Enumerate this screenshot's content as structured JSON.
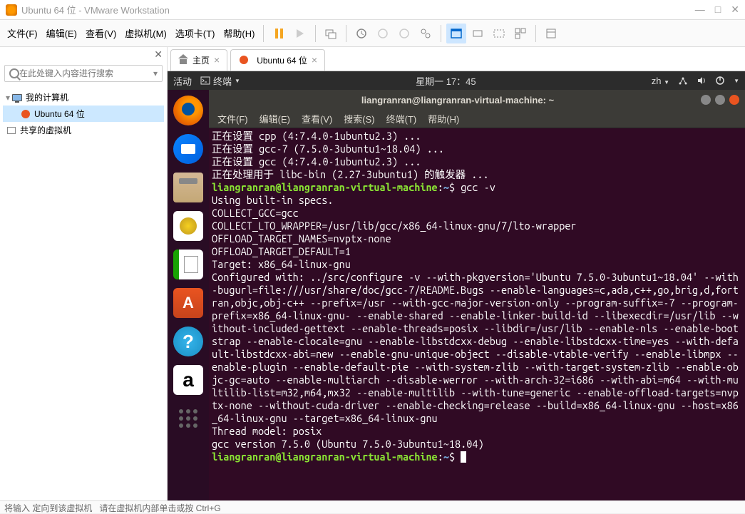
{
  "window": {
    "title": "Ubuntu 64 位 - VMware Workstation"
  },
  "menu": {
    "file": "文件(F)",
    "edit": "编辑(E)",
    "view": "查看(V)",
    "vm": "虚拟机(M)",
    "tabs": "选项卡(T)",
    "help": "帮助(H)"
  },
  "sidebar": {
    "search_placeholder": "在此处键入内容进行搜索",
    "tree": {
      "root": "我的计算机",
      "vm": "Ubuntu 64 位",
      "shared": "共享的虚拟机"
    }
  },
  "tabs": {
    "home": "主页",
    "vm": "Ubuntu 64 位"
  },
  "gnome": {
    "activities": "活动",
    "app": "终端",
    "clock": "星期一 17：45",
    "lang": "zh"
  },
  "terminal": {
    "title": "liangranran@liangranran-virtual-machine: ~",
    "menu": {
      "file": "文件(F)",
      "edit": "编辑(E)",
      "view": "查看(V)",
      "search": "搜索(S)",
      "terminal": "终端(T)",
      "help": "帮助(H)"
    },
    "lines": [
      "正在设置 cpp (4:7.4.0-1ubuntu2.3) ...",
      "正在设置 gcc-7 (7.5.0-3ubuntu1~18.04) ...",
      "正在设置 gcc (4:7.4.0-1ubuntu2.3) ...",
      "正在处理用于 libc-bin (2.27-3ubuntu1) 的触发器 ..."
    ],
    "prompt1_user": "liangranran@liangranran-virtual-machine",
    "prompt1_path": "~",
    "prompt1_cmd": "gcc -v",
    "gcc_output": "Using built-in specs.\nCOLLECT_GCC=gcc\nCOLLECT_LTO_WRAPPER=/usr/lib/gcc/x86_64-linux-gnu/7/lto-wrapper\nOFFLOAD_TARGET_NAMES=nvptx-none\nOFFLOAD_TARGET_DEFAULT=1\nTarget: x86_64-linux-gnu\nConfigured with: ../src/configure -v --with-pkgversion='Ubuntu 7.5.0-3ubuntu1~18.04' --with-bugurl=file:///usr/share/doc/gcc-7/README.Bugs --enable-languages=c,ada,c++,go,brig,d,fortran,objc,obj-c++ --prefix=/usr --with-gcc-major-version-only --program-suffix=-7 --program-prefix=x86_64-linux-gnu- --enable-shared --enable-linker-build-id --libexecdir=/usr/lib --without-included-gettext --enable-threads=posix --libdir=/usr/lib --enable-nls --enable-bootstrap --enable-clocale=gnu --enable-libstdcxx-debug --enable-libstdcxx-time=yes --with-default-libstdcxx-abi=new --enable-gnu-unique-object --disable-vtable-verify --enable-libmpx --enable-plugin --enable-default-pie --with-system-zlib --with-target-system-zlib --enable-objc-gc=auto --enable-multiarch --disable-werror --with-arch-32=i686 --with-abi=m64 --with-multilib-list=m32,m64,mx32 --enable-multilib --with-tune=generic --enable-offload-targets=nvptx-none --without-cuda-driver --enable-checking=release --build=x86_64-linux-gnu --host=x86_64-linux-gnu --target=x86_64-linux-gnu\nThread model: posix\ngcc version 7.5.0 (Ubuntu 7.5.0-3ubuntu1~18.04)",
    "prompt2_user": "liangranran@liangranran-virtual-machine",
    "prompt2_path": "~"
  },
  "statusbar": {
    "hint1": "将输入 定向到该虚拟机",
    "hint2": "请在虚拟机内部单击或按 Ctrl+G"
  }
}
